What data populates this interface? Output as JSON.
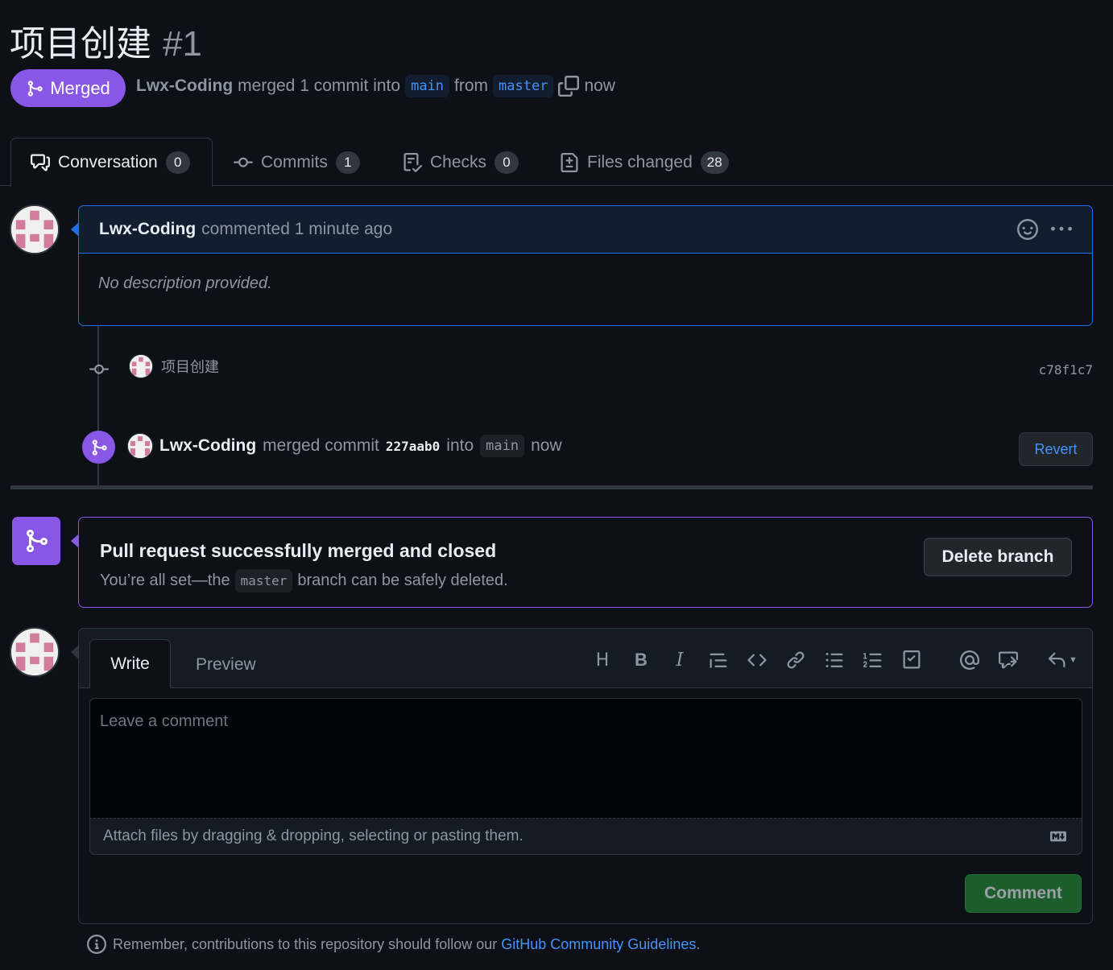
{
  "pr": {
    "title": "项目创建",
    "number": "#1",
    "status": "Merged",
    "author": "Lwx-Coding",
    "summary_a": "merged 1 commit into",
    "base_branch": "main",
    "summary_b": "from",
    "head_branch": "master",
    "time": "now"
  },
  "tabs": [
    {
      "label": "Conversation",
      "count": "0"
    },
    {
      "label": "Commits",
      "count": "1"
    },
    {
      "label": "Checks",
      "count": "0"
    },
    {
      "label": "Files changed",
      "count": "28"
    }
  ],
  "comment": {
    "author": "Lwx-Coding",
    "action": "commented 1 minute ago",
    "body": "No description provided."
  },
  "commit": {
    "message": "项目创建",
    "sha": "c78f1c7"
  },
  "merge_event": {
    "author": "Lwx-Coding",
    "text_a": "merged commit",
    "sha": "227aab0",
    "text_b": "into",
    "branch": "main",
    "time": "now",
    "revert_label": "Revert"
  },
  "merge_panel": {
    "title": "Pull request successfully merged and closed",
    "sub_a": "You’re all set—the",
    "branch": "master",
    "sub_b": "branch can be safely deleted.",
    "delete_label": "Delete branch"
  },
  "editor": {
    "write_tab": "Write",
    "preview_tab": "Preview",
    "placeholder": "Leave a comment",
    "attach_text": "Attach files by dragging & dropping, selecting or pasting them.",
    "comment_label": "Comment",
    "toolbar": [
      "heading-icon",
      "bold-icon",
      "italic-icon",
      "quote-icon",
      "code-icon",
      "link-icon",
      "unordered-list-icon",
      "ordered-list-icon",
      "task-list-icon",
      "mention-icon",
      "reference-icon",
      "reply-icon"
    ]
  },
  "footer": {
    "text": "Remember, contributions to this repository should follow our",
    "link": "GitHub Community Guidelines",
    "end": "."
  },
  "colors": {
    "merged": "#8957e5",
    "link": "#4493f8",
    "success": "#238636",
    "comment_border": "#1f6feb"
  }
}
